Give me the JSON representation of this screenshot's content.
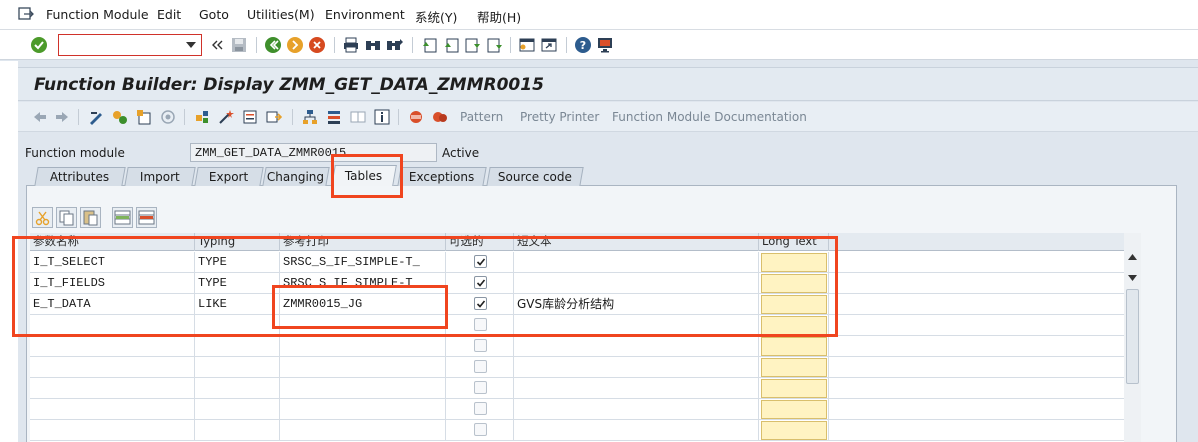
{
  "menu": {
    "items": [
      {
        "label": "Function Module"
      },
      {
        "label": "Edit"
      },
      {
        "label": "Goto"
      },
      {
        "label": "Utilities(M)"
      },
      {
        "label": "Environment"
      },
      {
        "label": "系统(Y)"
      },
      {
        "label": "帮助(H)"
      }
    ]
  },
  "command_field": {
    "value": ""
  },
  "title": "Function Builder: Display ZMM_GET_DATA_ZMMR0015",
  "app_toolbar": {
    "pattern": "Pattern",
    "pretty_printer": "Pretty Printer",
    "fm_documentation": "Function Module Documentation"
  },
  "header": {
    "fm_label": "Function module",
    "fm_value": "ZMM_GET_DATA_ZMMR0015",
    "status": "Active"
  },
  "tabs": [
    {
      "label": "Attributes"
    },
    {
      "label": "Import"
    },
    {
      "label": "Export"
    },
    {
      "label": "Changing"
    },
    {
      "label": "Tables",
      "active": true
    },
    {
      "label": "Exceptions"
    },
    {
      "label": "Source code"
    }
  ],
  "table": {
    "columns": [
      "参数名称",
      "Typing",
      "参考打印",
      "可选的",
      "短文本",
      "Long Text"
    ],
    "rows": [
      {
        "name": "I_T_SELECT",
        "typing": "TYPE",
        "ref": "SRSC_S_IF_SIMPLE-T_",
        "optional": true,
        "short_text": ""
      },
      {
        "name": "I_T_FIELDS",
        "typing": "TYPE",
        "ref": "SRSC_S_IF_SIMPLE-T_",
        "optional": true,
        "short_text": ""
      },
      {
        "name": "E_T_DATA",
        "typing": "LIKE",
        "ref": "ZMMR0015_JG",
        "optional": true,
        "short_text": "GVS库龄分析结构"
      },
      {
        "name": "",
        "typing": "",
        "ref": "",
        "optional": false,
        "short_text": ""
      },
      {
        "name": "",
        "typing": "",
        "ref": "",
        "optional": false,
        "short_text": ""
      },
      {
        "name": "",
        "typing": "",
        "ref": "",
        "optional": false,
        "short_text": ""
      },
      {
        "name": "",
        "typing": "",
        "ref": "",
        "optional": false,
        "short_text": ""
      },
      {
        "name": "",
        "typing": "",
        "ref": "",
        "optional": false,
        "short_text": ""
      },
      {
        "name": "",
        "typing": "",
        "ref": "",
        "optional": false,
        "short_text": ""
      }
    ]
  },
  "colors": {
    "highlight": "#f0451f",
    "long_text_button": "#fff3c2"
  }
}
